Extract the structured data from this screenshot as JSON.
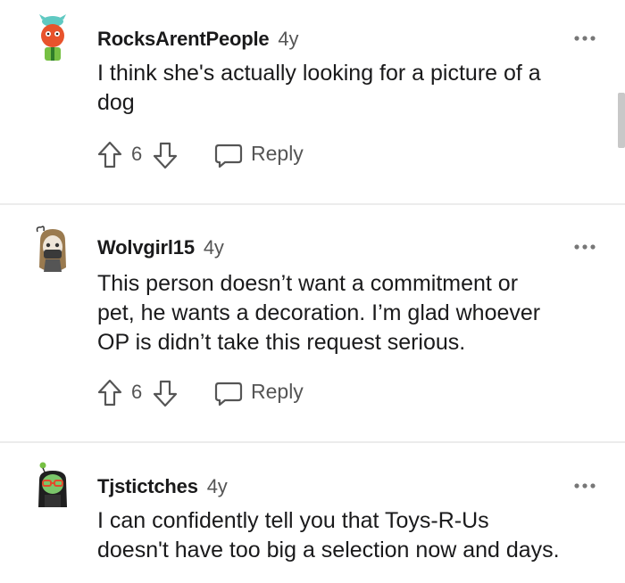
{
  "comments": [
    {
      "username": "RocksArentPeople",
      "age": "4y",
      "text": "I think she's actually looking for a picture of a\ndog",
      "score": "6",
      "reply_label": "Reply"
    },
    {
      "username": "Wolvgirl15",
      "age": "4y",
      "text": "This person doesn’t want a commitment or\npet, he wants a decoration. I’m glad whoever\nOP is didn’t take this request serious.",
      "score": "6",
      "reply_label": "Reply"
    },
    {
      "username": "Tjstictches",
      "age": "4y",
      "text": "I can confidently tell you that Toys-R-Us\ndoesn't have too big a selection now and days."
    }
  ],
  "icons": {
    "upvote": "arrow-up-outline-icon",
    "downvote": "arrow-down-outline-icon",
    "reply": "speech-bubble-icon",
    "more": "ellipsis-icon"
  },
  "colors": {
    "text": "#1a1a1b",
    "meta": "#555555",
    "divider": "#ececec"
  }
}
